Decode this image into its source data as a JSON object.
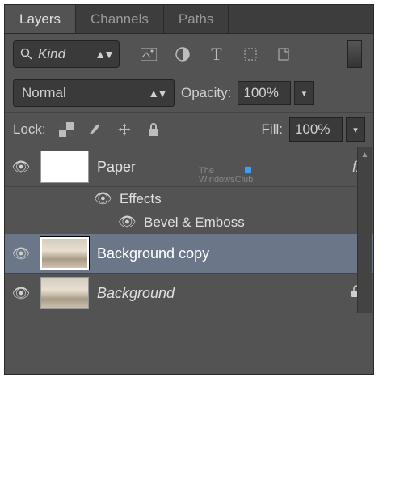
{
  "tabs": {
    "layers": "Layers",
    "channels": "Channels",
    "paths": "Paths"
  },
  "filter": {
    "kind": "Kind"
  },
  "blend": {
    "mode": "Normal",
    "opacity_label": "Opacity:",
    "opacity_value": "100%"
  },
  "lock": {
    "label": "Lock:",
    "fill_label": "Fill:",
    "fill_value": "100%"
  },
  "layers": {
    "paper": "Paper",
    "effects": "Effects",
    "bevel": "Bevel & Emboss",
    "bgcopy": "Background copy",
    "bg": "Background",
    "fx": "fx"
  },
  "watermark": {
    "line1": "The",
    "line2": "WindowsClub"
  }
}
